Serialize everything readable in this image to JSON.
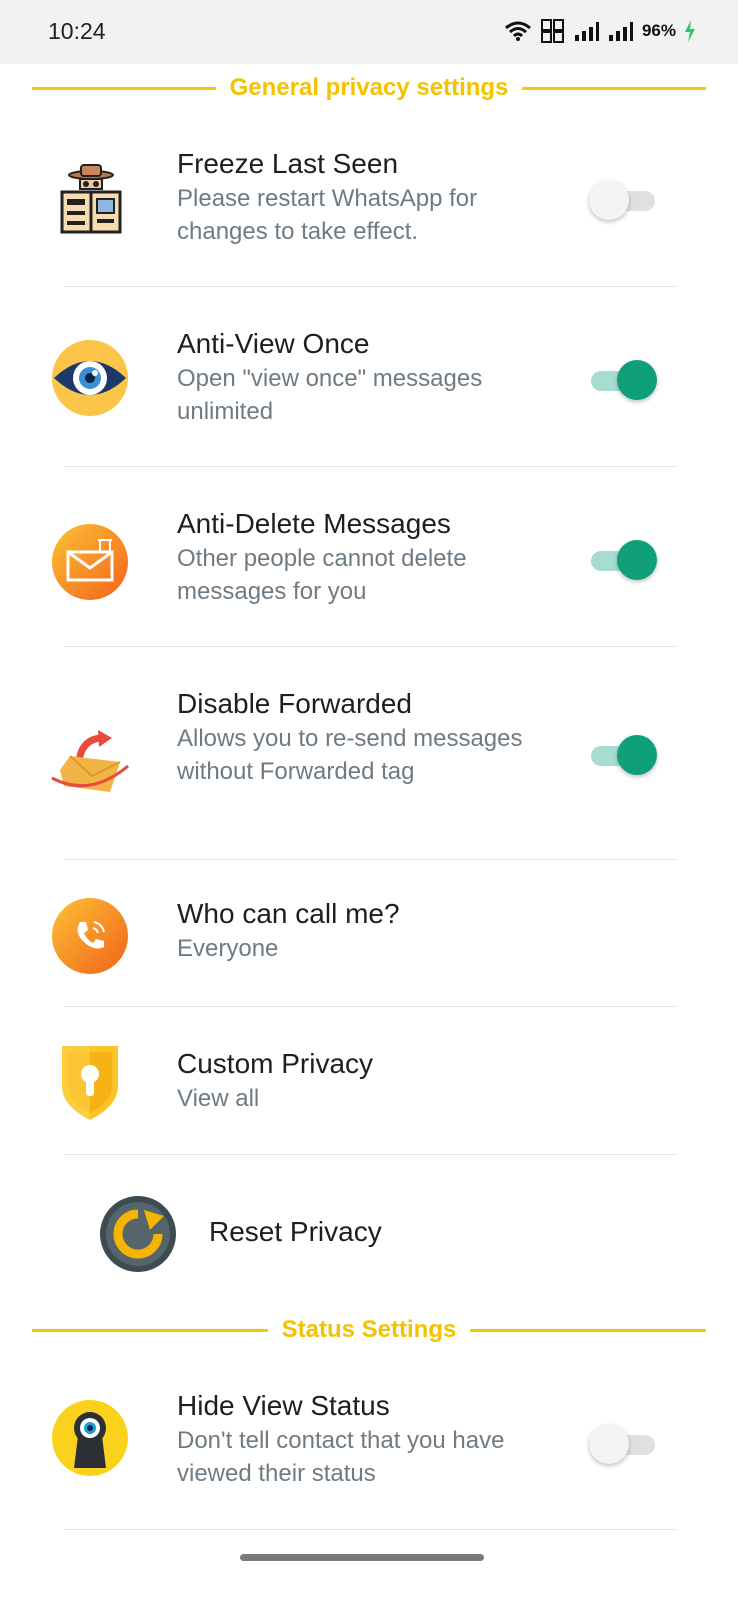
{
  "status_bar": {
    "time": "10:24",
    "battery": "96%"
  },
  "sections": {
    "general": {
      "title": "General privacy settings"
    },
    "status": {
      "title": "Status Settings"
    }
  },
  "items": [
    {
      "title": "Freeze Last Seen",
      "subtitle": "Please restart WhatsApp for changes to take effect.",
      "toggle": false,
      "icon": "spy-newspaper-icon"
    },
    {
      "title": "Anti-View Once",
      "subtitle": "Open \"view once\" messages unlimited",
      "toggle": true,
      "icon": "eye-icon"
    },
    {
      "title": "Anti-Delete Messages",
      "subtitle": "Other people cannot delete messages for you",
      "toggle": true,
      "icon": "envelope-trash-icon"
    },
    {
      "title": "Disable Forwarded",
      "subtitle": "Allows you to re-send messages without Forwarded tag",
      "toggle": true,
      "icon": "forward-envelope-icon"
    },
    {
      "title": "Who can call me?",
      "subtitle": "Everyone",
      "icon": "phone-call-icon"
    },
    {
      "title": "Custom Privacy",
      "subtitle": "View all",
      "icon": "shield-lock-icon"
    },
    {
      "title": "Reset Privacy",
      "icon": "reset-icon"
    },
    {
      "title": "Hide View Status",
      "subtitle": "Don't tell contact that you have viewed their status",
      "toggle": false,
      "icon": "keyhole-eye-icon"
    }
  ],
  "colors": {
    "accent_yellow": "#f5c200",
    "toggle_on": "#0f9f7b",
    "toggle_on_track": "#a7ddd0",
    "toggle_off_track": "#e0e0e0"
  }
}
